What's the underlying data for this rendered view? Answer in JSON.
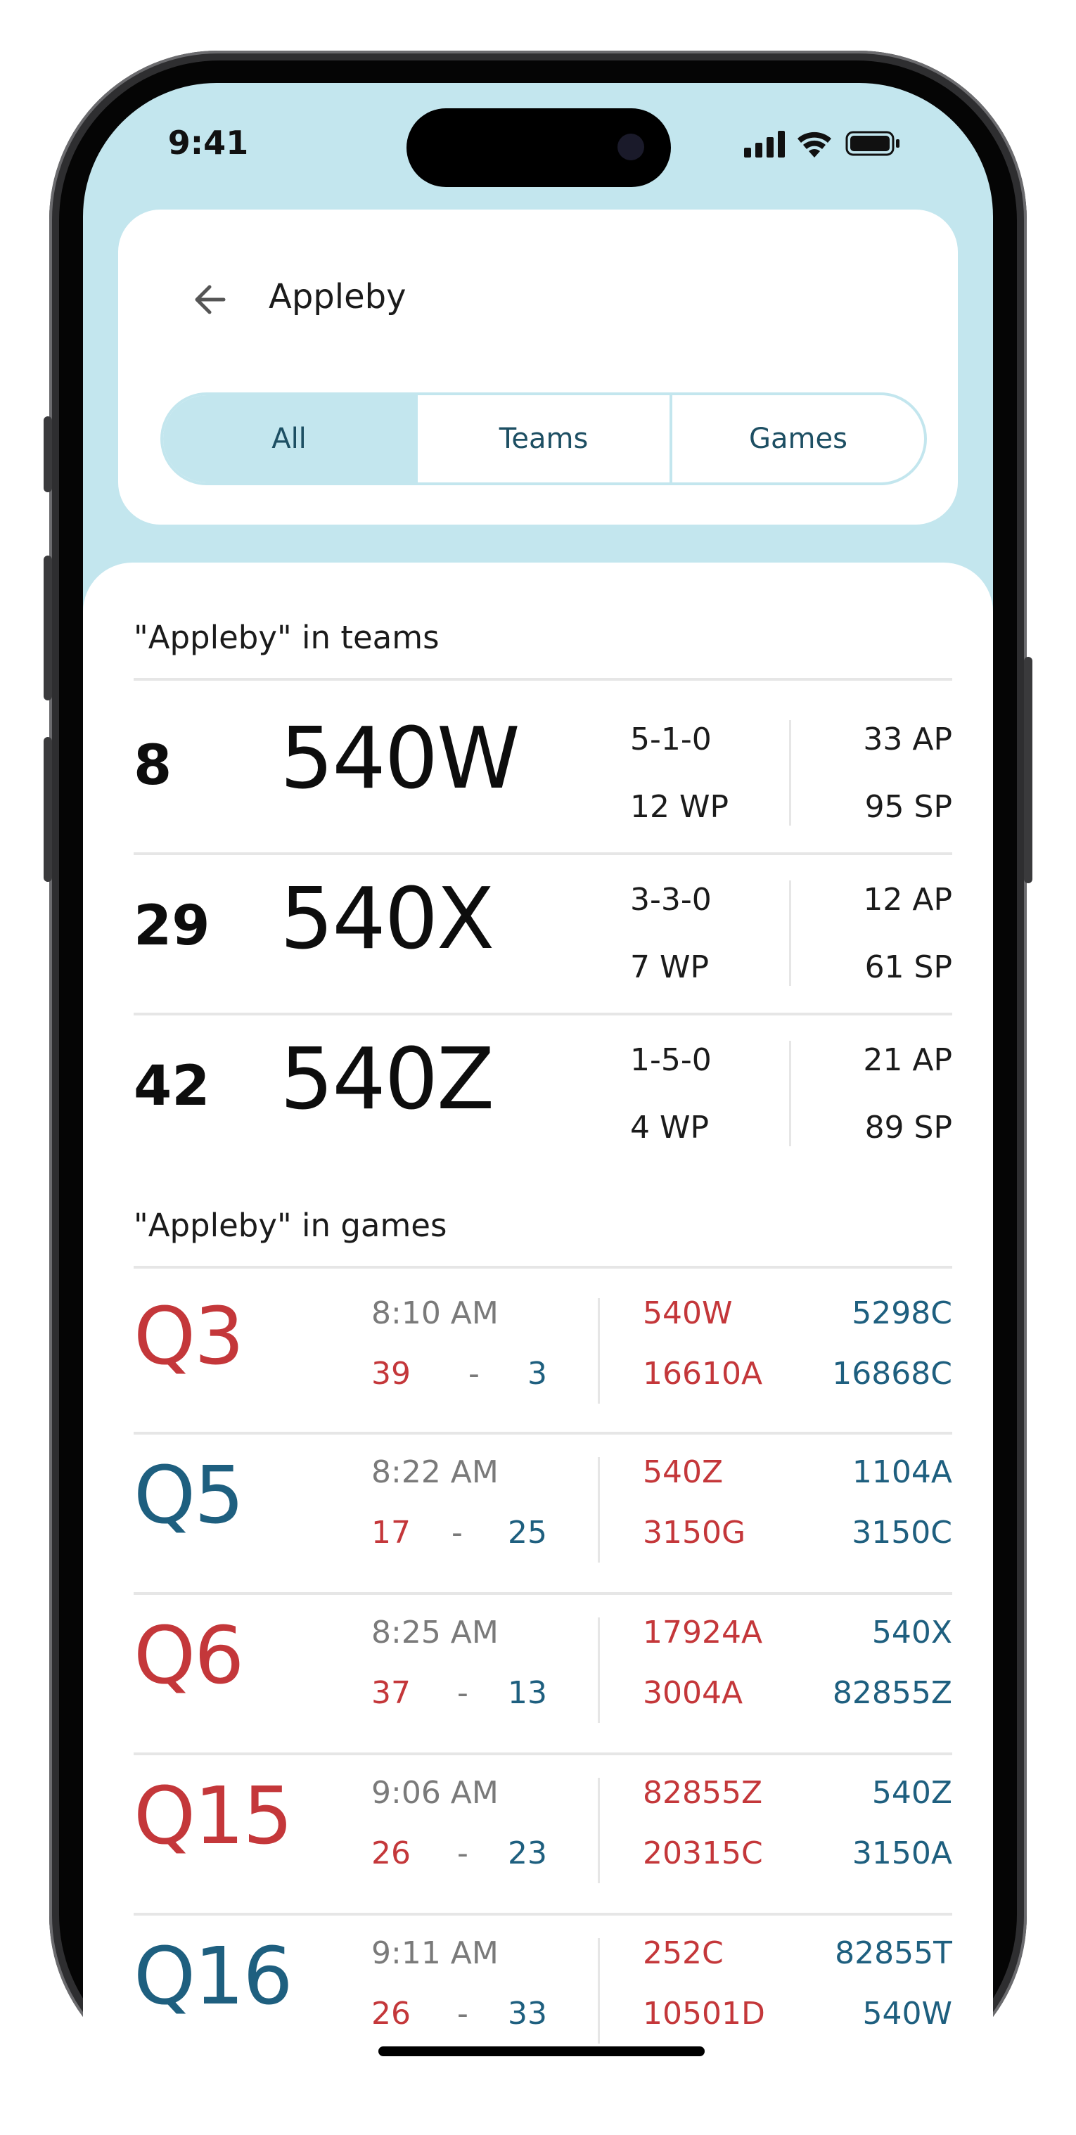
{
  "status_bar": {
    "time": "9:41"
  },
  "header": {
    "title": "Appleby",
    "tabs": [
      {
        "label": "All",
        "active": true
      },
      {
        "label": "Teams",
        "active": false
      },
      {
        "label": "Games",
        "active": false
      }
    ]
  },
  "teams_section": {
    "title": "\"Appleby\" in teams",
    "rows": [
      {
        "rank": "8",
        "number": "540W",
        "record": "5-1-0",
        "wp": "12 WP",
        "ap": "33 AP",
        "sp": "95 SP"
      },
      {
        "rank": "29",
        "number": "540X",
        "record": "3-3-0",
        "wp": "7 WP",
        "ap": "12 AP",
        "sp": "61 SP"
      },
      {
        "rank": "42",
        "number": "540Z",
        "record": "1-5-0",
        "wp": "4 WP",
        "ap": "21 AP",
        "sp": "89 SP"
      }
    ]
  },
  "games_section": {
    "title": "\"Appleby\" in games",
    "rows": [
      {
        "label": "Q3",
        "label_color": "red",
        "time": "8:10 AM",
        "red_score": "39",
        "sep": "-",
        "blue_score": "3",
        "red_team_1": "540W",
        "red_team_2": "16610A",
        "blue_team_1": "5298C",
        "blue_team_2": "16868C"
      },
      {
        "label": "Q5",
        "label_color": "blue",
        "time": "8:22 AM",
        "red_score": "17",
        "sep": "-",
        "blue_score": "25",
        "red_team_1": "540Z",
        "red_team_2": "3150G",
        "blue_team_1": "1104A",
        "blue_team_2": "3150C"
      },
      {
        "label": "Q6",
        "label_color": "red",
        "time": "8:25 AM",
        "red_score": "37",
        "sep": "-",
        "blue_score": "13",
        "red_team_1": "17924A",
        "red_team_2": "3004A",
        "blue_team_1": "540X",
        "blue_team_2": "82855Z"
      },
      {
        "label": "Q15",
        "label_color": "red",
        "time": "9:06 AM",
        "red_score": "26",
        "sep": "-",
        "blue_score": "23",
        "red_team_1": "82855Z",
        "red_team_2": "20315C",
        "blue_team_1": "540Z",
        "blue_team_2": "3150A"
      },
      {
        "label": "Q16",
        "label_color": "blue",
        "time": "9:11 AM",
        "red_score": "26",
        "sep": "-",
        "blue_score": "33",
        "red_team_1": "252C",
        "red_team_2": "10501D",
        "blue_team_1": "82855T",
        "blue_team_2": "540W"
      }
    ]
  },
  "colors": {
    "accent": "#c3e6ee",
    "red": "#c4373a",
    "blue": "#1e5f7f"
  },
  "icons": {
    "back": "arrow-left-icon",
    "signal": "cellular-signal-icon",
    "wifi": "wifi-icon",
    "battery": "battery-icon"
  }
}
